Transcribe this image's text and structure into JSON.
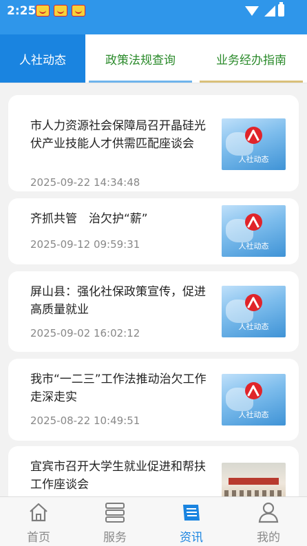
{
  "status_bar": {
    "time": "2:25"
  },
  "tabs": [
    {
      "label": "人社动态",
      "active": true
    },
    {
      "label": "政策法规查询",
      "active": false
    },
    {
      "label": "业务经办指南",
      "active": false
    }
  ],
  "thumbnail_caption": "人社动态",
  "articles": [
    {
      "title": "市人力资源社会保障局召开晶硅光伏产业技能人才供需匹配座谈会",
      "date": "2025-09-22 14:34:48"
    },
    {
      "title": "齐抓共管　治欠护“薪”",
      "date": "2025-09-12 09:59:31"
    },
    {
      "title": "屏山县：强化社保政策宣传，促进高质量就业",
      "date": "2025-09-02 16:02:12"
    },
    {
      "title": "我市“一二三”工作法推动治欠工作走深走实",
      "date": "2025-08-22 10:49:51"
    },
    {
      "title": "宜宾市召开大学生就业促进和帮扶工作座谈会",
      "date": ""
    }
  ],
  "bottom_nav": [
    {
      "label": "首页",
      "icon": "home-icon",
      "active": false
    },
    {
      "label": "服务",
      "icon": "service-icon",
      "active": false
    },
    {
      "label": "资讯",
      "icon": "news-icon",
      "active": true
    },
    {
      "label": "我的",
      "icon": "profile-icon",
      "active": false
    }
  ],
  "colors": {
    "status_bar": "#2f96ea",
    "active_tab": "#1a84e0",
    "tab_text": "#2a8a2a",
    "active_nav": "#1a84e0"
  }
}
